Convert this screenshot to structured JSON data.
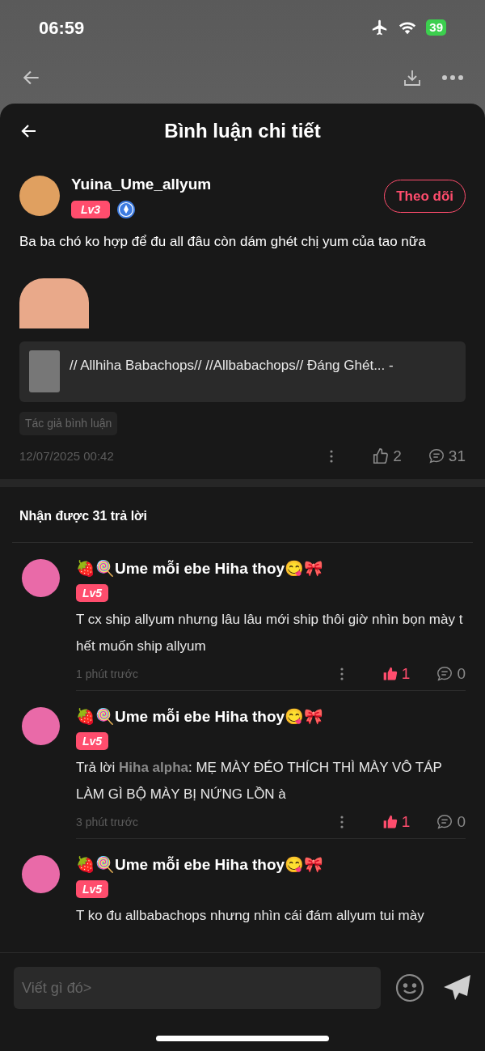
{
  "status_bar": {
    "time": "06:59",
    "battery": "39"
  },
  "header": {
    "title": "Bình luận chi tiết"
  },
  "comment": {
    "author": "Yuina_Ume_allyum",
    "level": "Lv3",
    "follow_button": "Theo dõi",
    "text": "Ba ba chó ko hợp để đu all đâu còn dám ghét chị yum của tao nữa",
    "link": "// Allhiha Babachops// //Allbabachops// Đáng Ghét... -",
    "tag": "Tác giả bình luận",
    "time": "12/07/2025 00:42",
    "likes": "2",
    "liked": false,
    "replies": "31"
  },
  "replies_heading": "Nhận được 31 trả lời",
  "replies": [
    {
      "author": "🍓🍭Ume mỗi ebe Hiha thoy😋🎀",
      "level": "Lv5",
      "text": "T cx ship allyum nhưng lâu lâu mới ship thôi giờ nhìn bọn mày t hết muốn ship allyum",
      "time": "1 phút trước",
      "likes": "1",
      "liked": true,
      "replies": "0"
    },
    {
      "author": "🍓🍭Ume mỗi ebe Hiha thoy😋🎀",
      "level": "Lv5",
      "text": "Trả lời **Hiha alpha**: MẸ MÀY ĐÉO THÍCH THÌ MÀY VÔ TÁP LÀM GÌ BỘ MÀY BỊ NỨNG LỒN à",
      "time": "3 phút trước",
      "likes": "1",
      "liked": true,
      "replies": "0"
    },
    {
      "author": "🍓🍭Ume mỗi ebe Hiha thoy😋🎀",
      "level": "Lv5",
      "text": "T ko đu allbabachops nhưng nhìn cái đám allyum tui mày"
    }
  ],
  "composer": {
    "placeholder": "Viết gì đó>"
  }
}
